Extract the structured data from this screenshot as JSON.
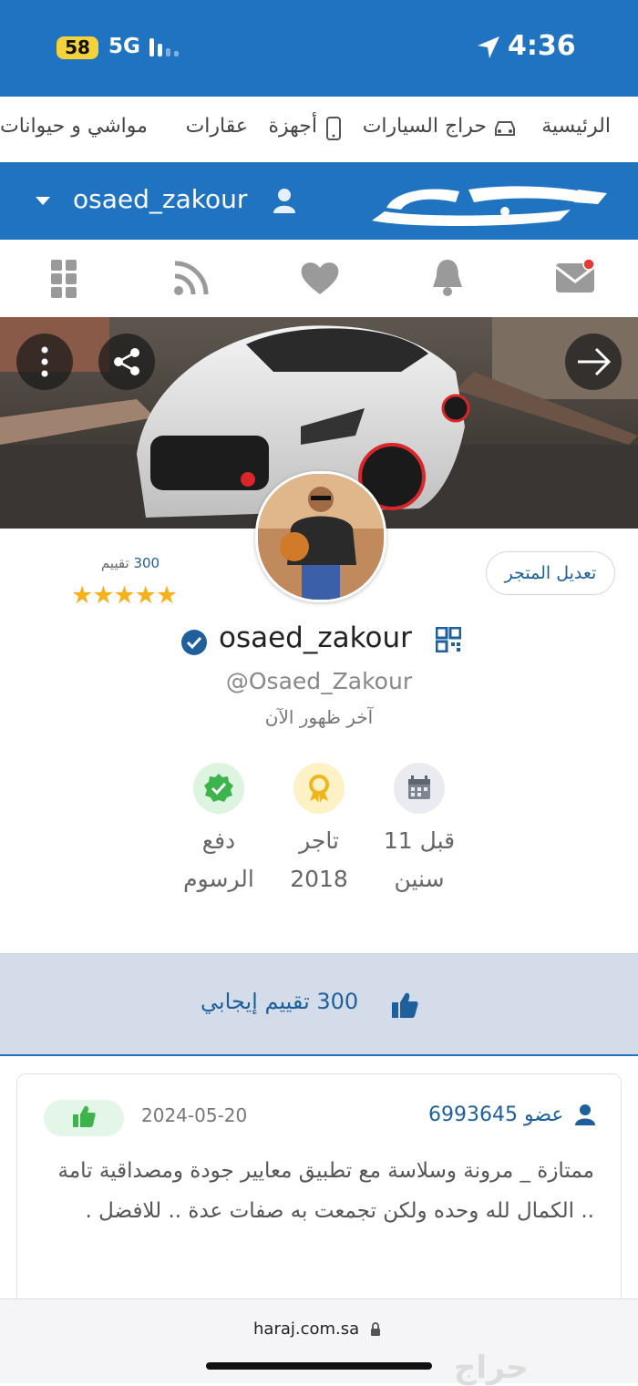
{
  "status_bar": {
    "battery": "58",
    "network": "5G",
    "time": "4:36"
  },
  "category_nav": {
    "items": [
      "الرئيسية",
      "حراج السيارات",
      "أجهزة",
      "عقارات",
      "مواشي و حيوانات"
    ]
  },
  "header": {
    "logo_text": "حراج",
    "username": "osaed_zakour"
  },
  "icon_bar": {
    "items": [
      "messages-icon",
      "bell-icon",
      "heart-icon",
      "rss-icon",
      "grid-icon"
    ]
  },
  "profile": {
    "edit_store_label": "تعديل المتجر",
    "rating_count": "300",
    "rating_word": "تقييم",
    "stars": "★★★★★",
    "username": "osaed_zakour",
    "handle": "@Osaed_Zakour",
    "last_seen": "آخر ظهور الآن"
  },
  "stats": [
    {
      "line1": "قبل 11",
      "line2": "سنين",
      "icon": "calendar-icon",
      "color": "#e9ebf0"
    },
    {
      "line1": "تاجر",
      "line2": "2018",
      "icon": "badge-icon",
      "color": "#fdf2c6"
    },
    {
      "line1": "دفع",
      "line2": "الرسوم",
      "icon": "verified-icon",
      "color": "#dcf4e0"
    }
  ],
  "ratings_band": {
    "label": "300 تقييم إيجابي"
  },
  "review": {
    "reviewer_prefix": "عضو",
    "reviewer_id": "6993645",
    "date": "2024-05-20",
    "text": "ممتازة _ مرونة وسلاسة مع تطبيق معايير جودة ومصداقية تامة .. الكمال لله وحده ولكن تجمعت به صفات عدة .. للافضل ."
  },
  "browser": {
    "url": "haraj.com.sa",
    "watermark": "حراج"
  },
  "colors": {
    "brand_blue": "#1f73c1",
    "star": "#f6b21a",
    "notification": "#e53935",
    "positive_green": "#3cb44b"
  }
}
